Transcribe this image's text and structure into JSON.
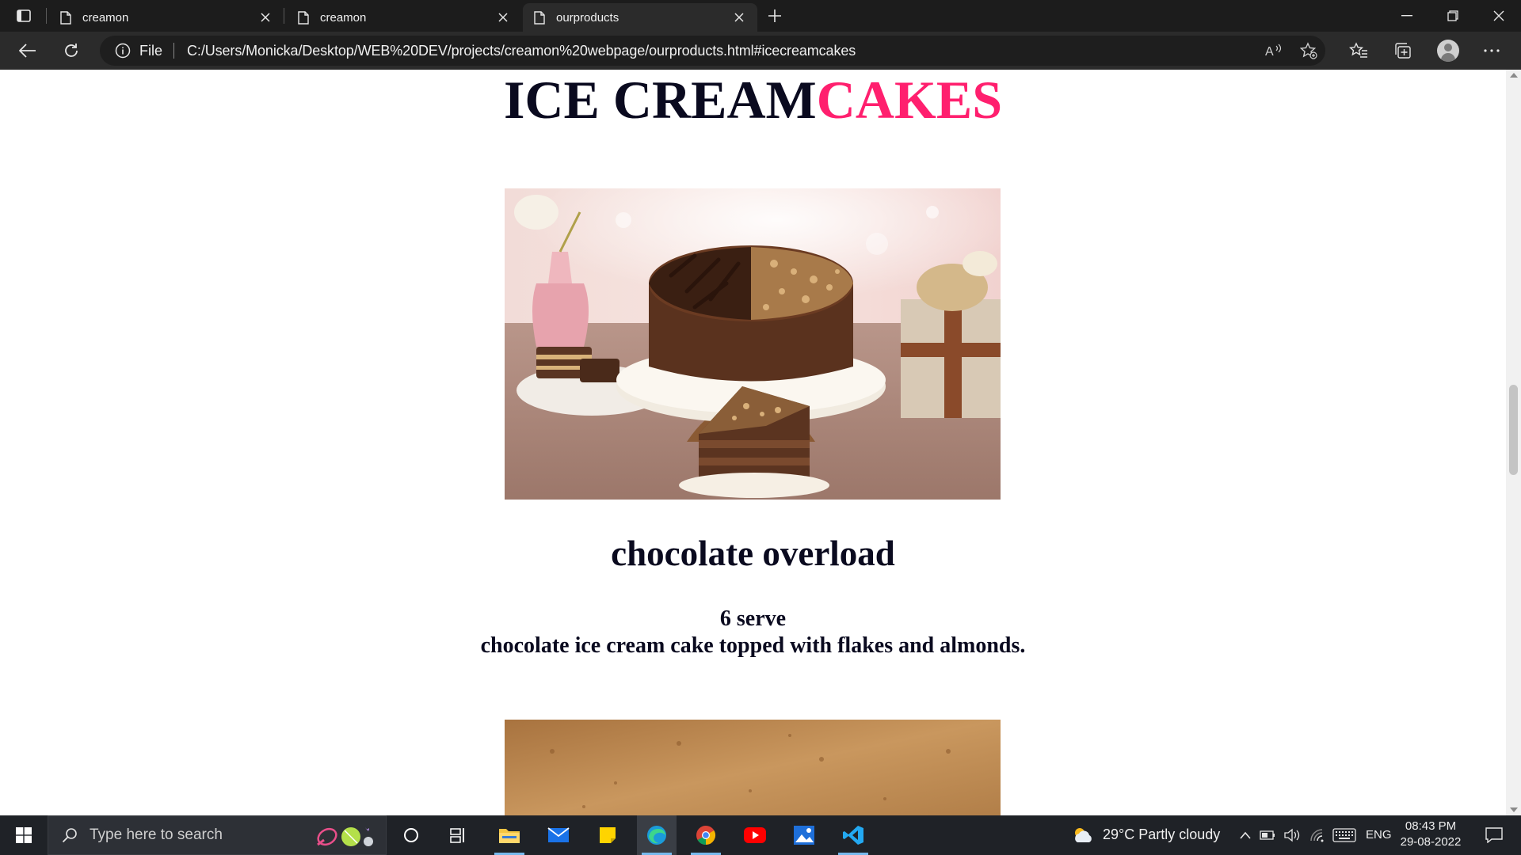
{
  "browser": {
    "tabs": [
      {
        "title": "creamon",
        "active": false
      },
      {
        "title": "creamon",
        "active": false
      },
      {
        "title": "ourproducts",
        "active": true
      }
    ],
    "address": {
      "scheme_label": "File",
      "url": "C:/Users/Monicka/Desktop/WEB%20DEV/projects/creamon%20webpage/ourproducts.html#icecreamcakes"
    }
  },
  "page": {
    "section_title_main": "ICE CREAM",
    "section_title_accent": "CAKES",
    "accent_color": "#ff1f6e",
    "product": {
      "name": "chocolate overload",
      "serve": "6 serve",
      "description": "chocolate ice cream cake topped with flakes and almonds."
    }
  },
  "taskbar": {
    "search_placeholder": "Type here to search",
    "weather": "29°C  Partly cloudy",
    "language": "ENG",
    "time": "08:43 PM",
    "date": "29-08-2022"
  }
}
